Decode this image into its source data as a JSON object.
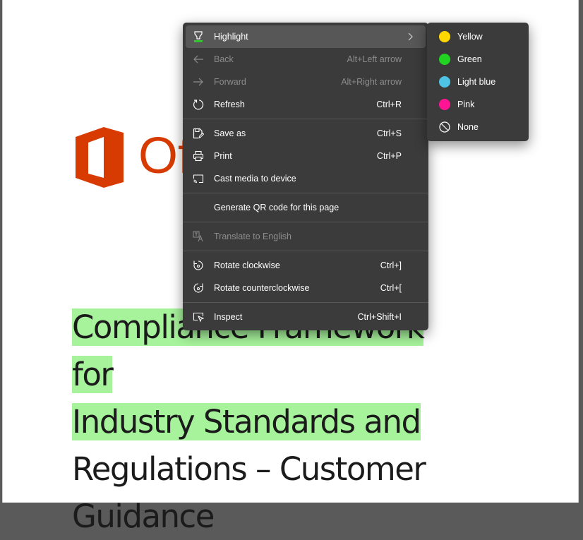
{
  "document": {
    "logo_text": "Of",
    "title_lines": [
      {
        "text": "Compliance Framework for",
        "highlight": "#a7f39c"
      },
      {
        "text": "Industry Standards and",
        "highlight": "#a7f39c"
      },
      {
        "text": "Regulations – Customer",
        "highlight": null
      },
      {
        "text": "Guidance",
        "highlight": null
      }
    ]
  },
  "context_menu": {
    "items": [
      {
        "label": "Highlight",
        "shortcut": "",
        "icon": "highlighter-icon",
        "state": "active",
        "has_submenu": true
      },
      {
        "label": "Back",
        "shortcut": "Alt+Left arrow",
        "icon": "back-arrow-icon",
        "state": "disabled"
      },
      {
        "label": "Forward",
        "shortcut": "Alt+Right arrow",
        "icon": "forward-arrow-icon",
        "state": "disabled"
      },
      {
        "label": "Refresh",
        "shortcut": "Ctrl+R",
        "icon": "refresh-icon",
        "state": "normal"
      },
      {
        "label": "Save as",
        "shortcut": "Ctrl+S",
        "icon": "save-as-icon",
        "state": "normal"
      },
      {
        "label": "Print",
        "shortcut": "Ctrl+P",
        "icon": "print-icon",
        "state": "normal"
      },
      {
        "label": "Cast media to device",
        "shortcut": "",
        "icon": "cast-icon",
        "state": "normal"
      },
      {
        "label": "Generate QR code for this page",
        "shortcut": "",
        "icon": "",
        "state": "normal"
      },
      {
        "label": "Translate to English",
        "shortcut": "",
        "icon": "translate-icon",
        "state": "disabled"
      },
      {
        "label": "Rotate clockwise",
        "shortcut": "Ctrl+]",
        "icon": "rotate-clockwise-icon",
        "state": "normal"
      },
      {
        "label": "Rotate counterclockwise",
        "shortcut": "Ctrl+[",
        "icon": "rotate-counterclockwise-icon",
        "state": "normal"
      },
      {
        "label": "Inspect",
        "shortcut": "Ctrl+Shift+I",
        "icon": "inspect-icon",
        "state": "normal"
      }
    ]
  },
  "highlight_submenu": {
    "items": [
      {
        "label": "Yellow",
        "color": "#ffd700"
      },
      {
        "label": "Green",
        "color": "#22d422"
      },
      {
        "label": "Light blue",
        "color": "#4fc3e6"
      },
      {
        "label": "Pink",
        "color": "#ff1493"
      },
      {
        "label": "None",
        "color": "none"
      }
    ]
  },
  "colors": {
    "menu_bg": "#3b3b3b",
    "menu_active": "#575757",
    "office_orange": "#d83b01",
    "text_highlight_green": "#a7f39c"
  }
}
